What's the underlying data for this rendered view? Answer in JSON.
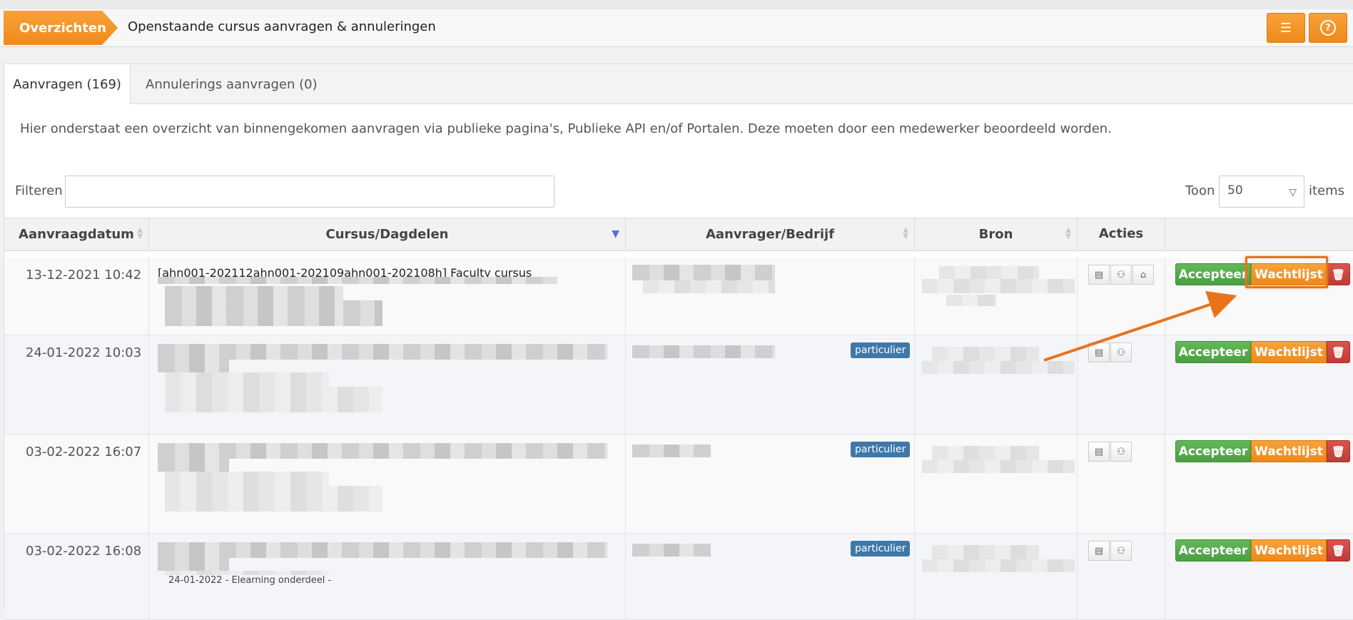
{
  "header": {
    "breadcrumb": "Overzichten",
    "title": "Openstaande cursus aanvragen & annuleringen",
    "buttons": [
      {
        "icon": "columns-settings-icon",
        "glyph": "☰"
      },
      {
        "icon": "help-icon",
        "glyph": "?"
      }
    ]
  },
  "tabs": [
    {
      "label": "Aanvragen (169)",
      "active": true
    },
    {
      "label": "Annulerings aanvragen (0)",
      "active": false
    }
  ],
  "intro": "Hier onderstaat een overzicht van binnengekomen aanvragen via publieke pagina's, Publieke API en/of Portalen. Deze moeten door een medewerker beoordeeld worden.",
  "filter": {
    "label": "Filteren",
    "value": ""
  },
  "pagesize": {
    "label": "Toon",
    "value": "50",
    "suffix": "items"
  },
  "columns": [
    "Aanvraagdatum",
    "Cursus/Dagdelen",
    "Aanvrager/Bedrijf",
    "Bron",
    "Acties"
  ],
  "rows": [
    {
      "date": "13-12-2021 10:42",
      "course": "[ahn001-202112ahn001-202109ahn001-202108h] Faculty cursus",
      "badge": ""
    },
    {
      "date": "24-01-2022 10:03",
      "course": "",
      "badge": "particulier"
    },
    {
      "date": "03-02-2022 16:07",
      "course": "",
      "badge": "particulier"
    },
    {
      "date": "03-02-2022 16:08",
      "course": "",
      "badge": "particulier",
      "extra": "24-01-2022 - Elearning onderdeel -"
    }
  ],
  "row_buttons": {
    "accept": "Accepteer",
    "wait": "Wachtlijst",
    "delete_glyph": "🗑"
  },
  "action_icons": {
    "details": "▤",
    "person": "⚇",
    "company": "⌂"
  },
  "colors": {
    "orange": "#f08c1c",
    "green": "#52a84a",
    "red": "#c9302c",
    "badge": "#3e78a8"
  }
}
